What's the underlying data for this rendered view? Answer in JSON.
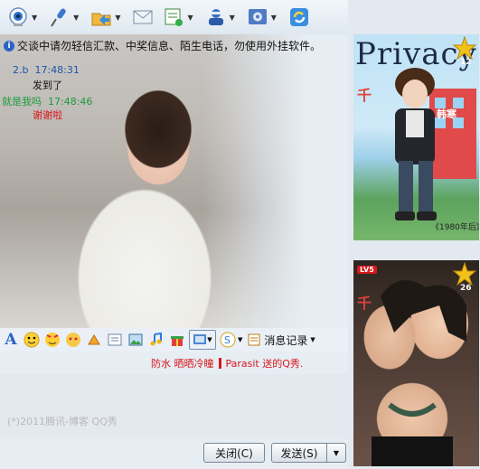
{
  "toolbar": {
    "items": [
      {
        "icon": "webcam-icon",
        "has_dropdown": true
      },
      {
        "icon": "microphone-icon",
        "has_dropdown": true
      },
      {
        "icon": "send-file-icon",
        "has_dropdown": true
      },
      {
        "icon": "email-icon",
        "has_dropdown": false
      },
      {
        "icon": "app-share-icon",
        "has_dropdown": true
      },
      {
        "icon": "group-chat-icon",
        "has_dropdown": true
      },
      {
        "icon": "settings-icon",
        "has_dropdown": true
      },
      {
        "icon": "refresh-icon",
        "has_dropdown": false
      }
    ]
  },
  "notice": {
    "text": "交谈中请勿轻信汇款、中奖信息、陌生电话，勿使用外挂软件。"
  },
  "messages": [
    {
      "sender": "2.b",
      "time": "17:48:31",
      "text": "发到了",
      "color": "#1d56a8"
    },
    {
      "sender": "就是我吗",
      "time": "17:48:46",
      "text": "谢谢啦",
      "color": "#1a9a3c",
      "text_color": "#d8161b"
    }
  ],
  "format_bar": {
    "icons": [
      "font-icon",
      "smiley-icon",
      "magic-face-icon",
      "emoji-icon",
      "shake-icon",
      "send-image-icon",
      "picture-icon",
      "music-icon",
      "gift-icon",
      "screenshot-icon",
      "soso-icon"
    ],
    "history_label": "消息记录"
  },
  "status": {
    "left": "防水 晒晒冷瞳",
    "right": "Parasit 送的Q秀."
  },
  "input": {
    "watermark": "(*)2011腾讯-博客 QQ秀"
  },
  "buttons": {
    "close_label": "关闭(C)",
    "send_label": "发送(S)"
  },
  "right_panel": {
    "magazine_title": "Privacy",
    "card_a_level": "12",
    "card_b_level": "26",
    "card_a_tag": "千",
    "card_b_tag": "千",
    "vip_badge": "LV5"
  },
  "colors": {
    "accent": "#2c63c6",
    "alert": "#d8161b",
    "panel": "#e6edf3"
  }
}
